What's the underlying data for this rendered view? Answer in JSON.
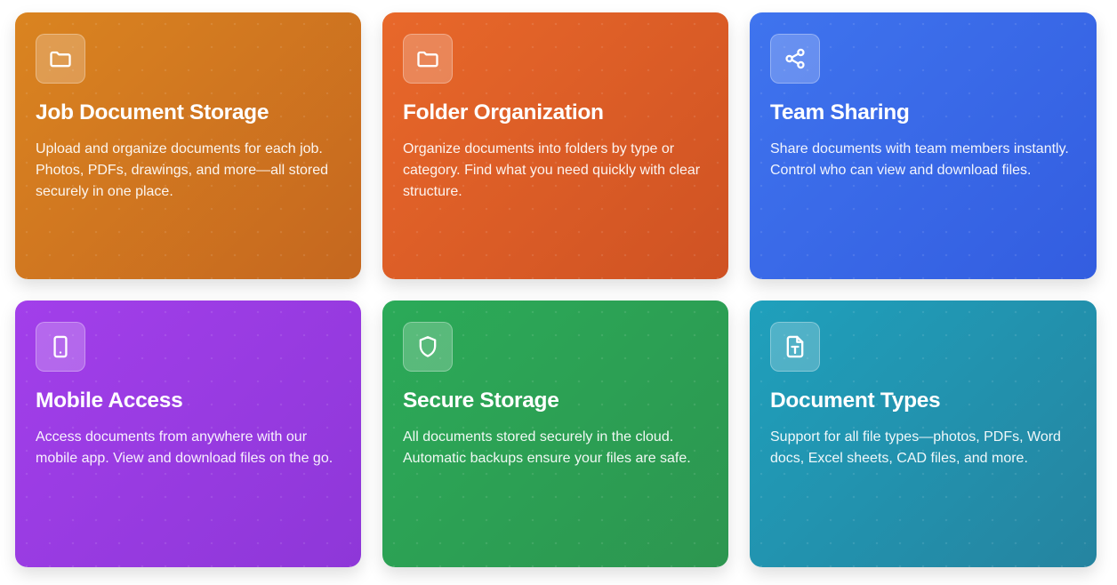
{
  "cards": [
    {
      "title": "Job Document Storage",
      "description": "Upload and organize documents for each job. Photos, PDFs, drawings, and more—all stored securely in one place.",
      "icon": "folder-icon",
      "color_start": "#DA8420",
      "color_end": "#C5671F"
    },
    {
      "title": "Folder Organization",
      "description": "Organize documents into folders by type or category. Find what you need quickly with clear structure.",
      "icon": "folder-icon",
      "color_start": "#E8682A",
      "color_end": "#CF5223"
    },
    {
      "title": "Team Sharing",
      "description": "Share documents with team members instantly. Control who can view and download files.",
      "icon": "share-icon",
      "color_start": "#3F74EE",
      "color_end": "#335DE0"
    },
    {
      "title": "Mobile Access",
      "description": "Access documents from anywhere with our mobile app. View and download files on the go.",
      "icon": "smartphone-icon",
      "color_start": "#A23FEA",
      "color_end": "#8E37D8"
    },
    {
      "title": "Secure Storage",
      "description": "All documents stored securely in the cloud. Automatic backups ensure your files are safe.",
      "icon": "shield-icon",
      "color_start": "#2BAA58",
      "color_end": "#2D9650"
    },
    {
      "title": "Document Types",
      "description": "Support for all file types—photos, PDFs, Word docs, Excel sheets, CAD files, and more.",
      "icon": "file-type-icon",
      "color_start": "#1FA0BC",
      "color_end": "#2584A0"
    }
  ]
}
